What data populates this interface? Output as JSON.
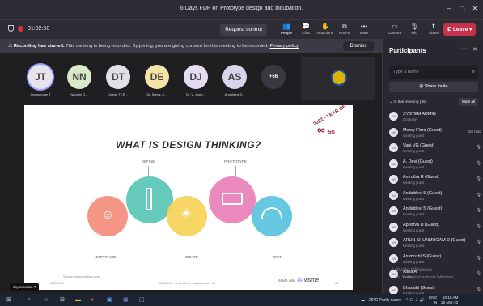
{
  "window": {
    "title": "6 Days FDP on Prototype design and incubation.",
    "controls": [
      "–",
      "▢",
      "✕"
    ]
  },
  "toolbar": {
    "timer": "01:02:50",
    "request_control": "Request control",
    "items": [
      {
        "label": "People",
        "icon": "people-icon",
        "glyph": "👥"
      },
      {
        "label": "Chat",
        "icon": "chat-icon",
        "glyph": "💬"
      },
      {
        "label": "Reactions",
        "icon": "reactions-icon",
        "glyph": "✋"
      },
      {
        "label": "Rooms",
        "icon": "rooms-icon",
        "glyph": "⧉"
      },
      {
        "label": "More",
        "icon": "more-icon",
        "glyph": "•••"
      },
      {
        "label": "Camera",
        "icon": "camera-icon",
        "glyph": "▭"
      },
      {
        "label": "Mic",
        "icon": "mic-icon",
        "glyph": "🎙"
      },
      {
        "label": "Share",
        "icon": "share-icon",
        "glyph": "⬆"
      }
    ],
    "leave": "Leave"
  },
  "banner": {
    "bold": "Recording has started.",
    "text": " This meeting is being recorded. By joining, you are giving consent for this meeting to be recorded. ",
    "link": "Privacy policy",
    "dismiss": "Dismiss"
  },
  "gallery": [
    {
      "initials": "JT",
      "name": "Jayanandan T",
      "color": "#e8e4ec"
    },
    {
      "initials": "NN",
      "name": "Nandini G...",
      "color": "#d8e8c8"
    },
    {
      "initials": "DT",
      "name": "Dinesh TCR ...",
      "color": "#e0e0e6"
    },
    {
      "initials": "DE",
      "name": "Dr. Suma- E...",
      "color": "#f4e4a8"
    },
    {
      "initials": "DJ",
      "name": "Dr. V. Jyoth...",
      "color": "#e4dcf0"
    },
    {
      "initials": "AS",
      "name": "Andaldevi S...",
      "color": "#d8d4ec"
    },
    {
      "initials": "+56",
      "name": "",
      "color": "#3a3942"
    }
  ],
  "slide": {
    "title": "WHAT IS DESIGN THINKING?",
    "stages": [
      "DEFINE",
      "PROTOTYPE",
      "EMPATHIZE",
      "IDEATE",
      "TEST"
    ],
    "badge_year": "2022 - YEAR OF",
    "badge_sub": "5G",
    "footer_left": "Source: www.medium.com",
    "footer_date": "3/22/2022",
    "footer_mid": "TNM9006 - Tesla Minds - Jayanandan TS",
    "footer_page": "34",
    "made_with": "Made with",
    "brand": "visme"
  },
  "speaker_tag": "Jayanandan T",
  "participants": {
    "title": "Participants",
    "search_placeholder": "Type a name",
    "share_invite": "Share invite",
    "section": "In this meeting (65)",
    "mute_all": "Mute all",
    "list": [
      {
        "initials": "SA",
        "name": "SYSTEM ADMIN",
        "role": "Organizer",
        "status": ""
      },
      {
        "initials": "MF",
        "name": "Mercy Flora (Guest)",
        "role": "Meeting guest",
        "status": "On hold"
      },
      {
        "initials": "VV",
        "name": "Vani VG (Guest)",
        "role": "Meeting guest",
        "status": ""
      },
      {
        "initials": "AD",
        "name": "A. Devi (Guest)",
        "role": "Meeting guest",
        "status": ""
      },
      {
        "initials": "AR",
        "name": "Amrutha R (Guest)",
        "role": "Meeting guest",
        "status": ""
      },
      {
        "initials": "AS",
        "name": "Andaldevi S (Guest)",
        "role": "Meeting guest",
        "status": ""
      },
      {
        "initials": "AS",
        "name": "Andaldevi S (Guest)",
        "role": "Meeting guest",
        "status": ""
      },
      {
        "initials": "AD",
        "name": "Apoorva D (Guest)",
        "role": "Meeting guest",
        "status": ""
      },
      {
        "initials": "AS",
        "name": "ARUN SHUNMUGAM D (Guest)",
        "role": "Meeting guest",
        "status": ""
      },
      {
        "initials": "AS",
        "name": "Arumozhi S (Guest)",
        "role": "Meeting guest",
        "status": ""
      },
      {
        "initials": "AA",
        "name": "Asha A",
        "role": "Guest",
        "status": ""
      },
      {
        "initials": "BS",
        "name": "Bharathi (Guest)",
        "role": "Meeting guest",
        "status": ""
      }
    ]
  },
  "watermark": {
    "line1": "Activate Windows",
    "line2": "Go to Settings to activate Windows."
  },
  "taskbar": {
    "weather": "26°C  Partly sunny",
    "lang": "ENG",
    "region": "IN",
    "time": "10:18 AM",
    "date": "22-Mar-22"
  }
}
